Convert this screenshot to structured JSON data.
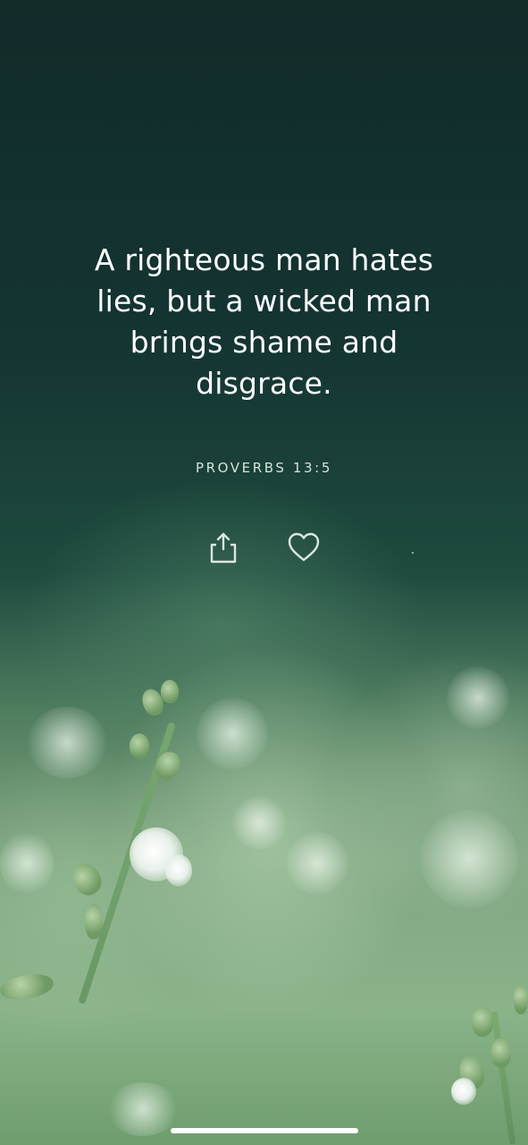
{
  "verse": {
    "text": "A righteous man hates lies, but a wicked man brings shame and disgrace.",
    "reference": "PROVERBS 13:5"
  },
  "actions": {
    "share_icon": "share-icon",
    "favorite_icon": "heart-icon"
  },
  "colors": {
    "text": "#ffffff",
    "reference": "#d6e3dc",
    "icon": "#dbe8df",
    "background_top": "#112b29",
    "background_bottom": "#8ab38a"
  }
}
